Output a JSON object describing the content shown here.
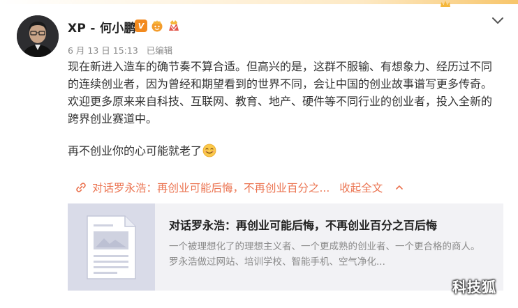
{
  "post": {
    "author": "XP - 何小鹏",
    "date": "6 月 13 日 15:13",
    "edited": "已编辑",
    "paragraph1": "现在新进入造车的确节奏不算合适。但高兴的是，这群不服输、有想象力、经历过不同的连续创业者，因为曾经和期望看到的世界不同，会让中国的创业故事谱写更多传奇。欢迎更多原来来自科技、互联网、教育、地产、硬件等不同行业的创业者，投入全新的跨界创业赛道中。",
    "paragraph2": "再不创业你的心可能就老了",
    "emoji": "smile-emoji"
  },
  "link": {
    "title": "对话罗永浩：再创业可能后悔，不再创业百分之...",
    "collapse_label": "收起全文"
  },
  "card": {
    "title": "对话罗永浩：再创业可能后悔，不再创业百分之百后悔",
    "description": "一个被理想化了的理想主义者、一个更成熟的创业者、一个更合格的商人。 罗永浩做过网站、培训学校、智能手机、空气净化..."
  },
  "badges": {
    "verified": "V"
  },
  "watermark": "科技狐",
  "colors": {
    "link": "#eb7350",
    "verified_badge": "#f28a1f",
    "card_bg": "#f2f2f5",
    "thumb_bg": "#d9dbe8"
  }
}
